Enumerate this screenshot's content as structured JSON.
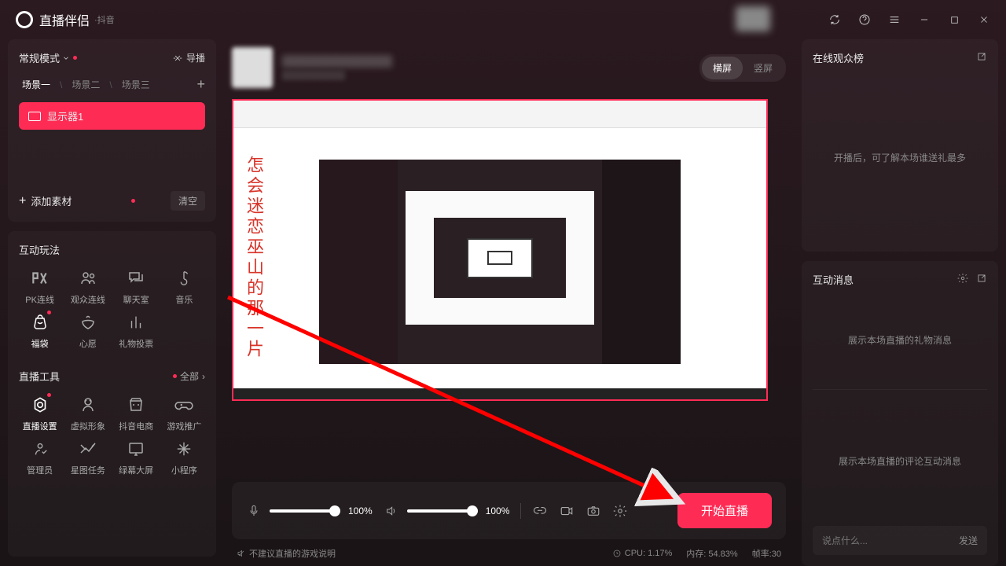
{
  "app": {
    "name": "直播伴侣",
    "sub": "·抖音"
  },
  "sidebar": {
    "mode": "常规模式",
    "guide": "导播",
    "scenes": [
      "场景一",
      "场景二",
      "场景三"
    ],
    "source": "显示器1",
    "add_material": "添加素材",
    "clear": "清空",
    "interactive_title": "互动玩法",
    "interactive": [
      {
        "label": "PK连线"
      },
      {
        "label": "观众连线"
      },
      {
        "label": "聊天室"
      },
      {
        "label": "音乐"
      },
      {
        "label": "福袋"
      },
      {
        "label": "心愿"
      },
      {
        "label": "礼物投票"
      }
    ],
    "tools_title": "直播工具",
    "all": "全部",
    "tools": [
      {
        "label": "直播设置"
      },
      {
        "label": "虚拟形象"
      },
      {
        "label": "抖音电商"
      },
      {
        "label": "游戏推广"
      },
      {
        "label": "管理员"
      },
      {
        "label": "星图任务"
      },
      {
        "label": "绿幕大屏"
      },
      {
        "label": "小程序"
      }
    ]
  },
  "center": {
    "orient_h": "横屏",
    "orient_v": "竖屏",
    "preview_text": "怎会迷恋巫山的那一片",
    "mic_vol": "100%",
    "spk_vol": "100%",
    "start": "开始直播",
    "game_hint": "不建议直播的游戏说明",
    "cpu": "CPU: 1.17%",
    "mem": "内存: 54.83%",
    "fps": "帧率:30"
  },
  "right": {
    "audience_title": "在线观众榜",
    "audience_hint": "开播后，可了解本场谁送礼最多",
    "msg_title": "互动消息",
    "gift_hint": "展示本场直播的礼物消息",
    "chat_hint": "展示本场直播的评论互动消息",
    "input_placeholder": "说点什么...",
    "send": "发送"
  }
}
